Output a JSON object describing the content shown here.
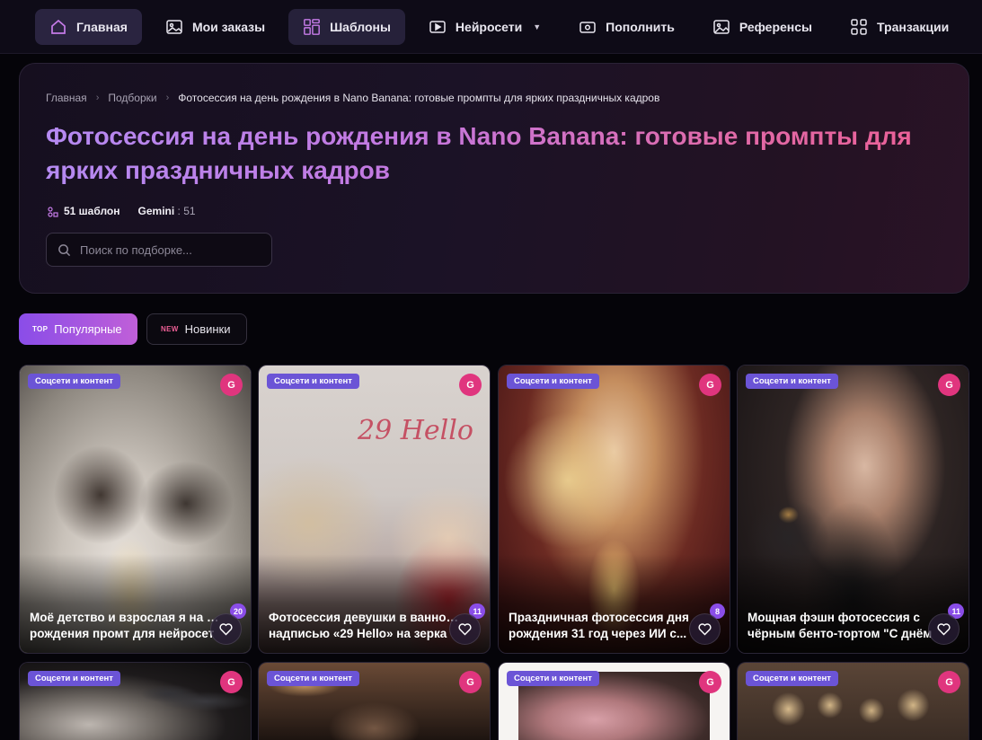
{
  "nav": {
    "items": [
      {
        "label": "Главная",
        "icon": "home-icon"
      },
      {
        "label": "Мои заказы",
        "icon": "gallery-icon"
      },
      {
        "label": "Шаблоны",
        "icon": "templates-grid-icon"
      },
      {
        "label": "Нейросети",
        "icon": "play-icon"
      },
      {
        "label": "Пополнить",
        "icon": "wallet-icon"
      },
      {
        "label": "Референсы",
        "icon": "image-icon"
      },
      {
        "label": "Транзакции",
        "icon": "grid-icon"
      }
    ]
  },
  "breadcrumb": {
    "home": "Главная",
    "section": "Подборки",
    "current": "Фотосессия на день рождения в Nano Banana: готовые промпты для ярких праздничных кадров"
  },
  "hero": {
    "title": "Фотосессия на день рождения в Nano Banana: готовые промпты для ярких праздничных кадров",
    "count_label": "51 шаблон",
    "model_name": "Gemini",
    "model_count": ": 51",
    "search_placeholder": "Поиск по подборке..."
  },
  "filters": {
    "top_tag": "TOP",
    "top_label": "Популярные",
    "new_tag": "NEW",
    "new_label": "Новинки"
  },
  "cards": [
    {
      "badge": "Соцсети и контент",
      "model": "G",
      "title_line1": "Моё детство и взрослая я на дне",
      "title_line2": "рождения промт для нейросет",
      "likes": "20"
    },
    {
      "badge": "Соцсети и контент",
      "model": "G",
      "title_line1": "Фотосессия девушки в ванной с",
      "title_line2": "надписью «29 Hello» на зерка",
      "likes": "11"
    },
    {
      "badge": "Соцсети и контент",
      "model": "G",
      "title_line1": "Праздничная фотосессия дня",
      "title_line2": "рождения 31 год через ИИ с...",
      "likes": "8"
    },
    {
      "badge": "Соцсети и контент",
      "model": "G",
      "title_line1": "Мощная фэшн фотосессия с",
      "title_line2": "чёрным бенто-тортом \"С днём",
      "likes": "11"
    },
    {
      "badge": "Соцсети и контент",
      "model": "G"
    },
    {
      "badge": "Соцсети и контент",
      "model": "G"
    },
    {
      "badge": "Соцсети и контент",
      "model": "G"
    },
    {
      "badge": "Соцсети и контент",
      "model": "G"
    }
  ],
  "colors": {
    "accent_purple": "#8a4de8",
    "accent_pink": "#e0357e",
    "badge": "#6b54d6",
    "background": "#050409"
  }
}
